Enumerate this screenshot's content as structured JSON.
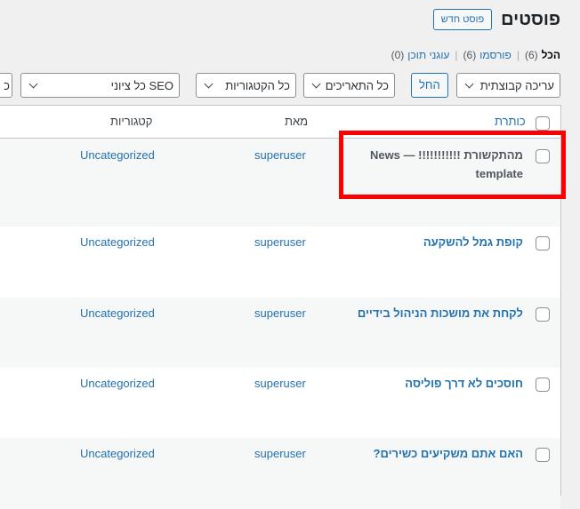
{
  "header": {
    "title": "פוסטים",
    "add_new_label": "פוסט חדש"
  },
  "filters": [
    {
      "label": "הכל",
      "count": "(6)",
      "current": true
    },
    {
      "label": "פורסמו",
      "count": "(6)",
      "current": false
    },
    {
      "label": "עוגני תוכן",
      "count": "(0)",
      "current": false
    }
  ],
  "toolbar": {
    "bulk_action": "עריכה קבוצתית",
    "apply_label": "החל",
    "dates": "כל התאריכים",
    "categories": "כל הקטגוריות",
    "seo": "כל ציוני SEO",
    "partial": "כ"
  },
  "columns": {
    "title": "כותרת",
    "author": "מאת",
    "categories": "קטגוריות"
  },
  "posts": [
    {
      "title": "מהתקשורת !!!!!!!!!!! — News template",
      "author": "superuser",
      "category": "Uncategorized"
    },
    {
      "title": "קופת גמל להשקעה",
      "author": "superuser",
      "category": "Uncategorized"
    },
    {
      "title": "לקחת את מושכות הניהול בידיים",
      "author": "superuser",
      "category": "Uncategorized"
    },
    {
      "title": "חוסכים לא דרך פוליסה",
      "author": "superuser",
      "category": "Uncategorized"
    },
    {
      "title": "האם אתם משקיעים כשירים?",
      "author": "superuser",
      "category": "Uncategorized"
    }
  ],
  "colors": {
    "link": "#2271b1",
    "highlight": "#ff0000",
    "background": "#f0f0f1"
  }
}
